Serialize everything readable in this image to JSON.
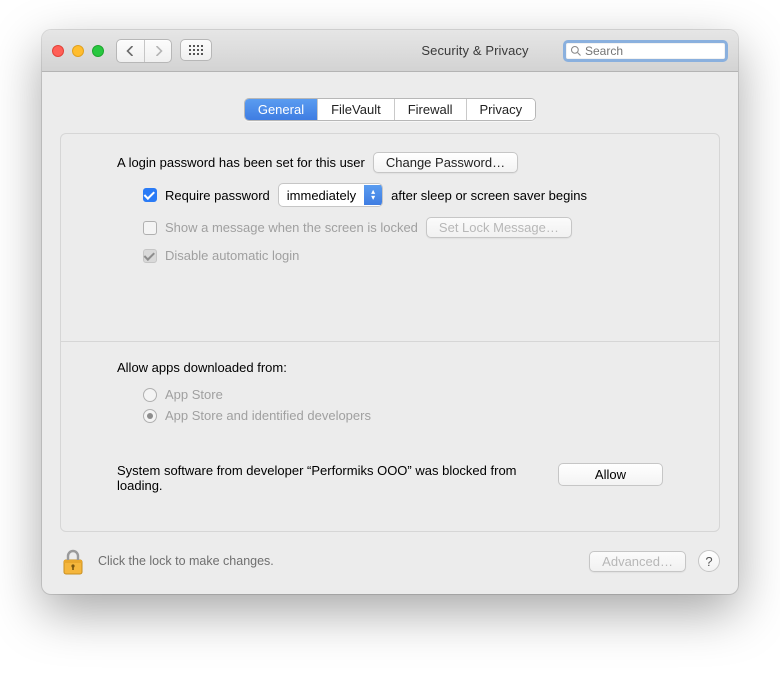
{
  "window": {
    "title": "Security & Privacy"
  },
  "search": {
    "placeholder": "Search"
  },
  "tabs": {
    "general": "General",
    "filevault": "FileVault",
    "firewall": "Firewall",
    "privacy": "Privacy"
  },
  "login": {
    "password_set_text": "A login password has been set for this user",
    "change_password_btn": "Change Password…",
    "require_password_label": "Require password",
    "delay_selected": "immediately",
    "after_sleep_text": "after sleep or screen saver begins",
    "show_message_label": "Show a message when the screen is locked",
    "set_lock_message_btn": "Set Lock Message…",
    "disable_auto_login_label": "Disable automatic login"
  },
  "download": {
    "heading": "Allow apps downloaded from:",
    "option_appstore": "App Store",
    "option_identified": "App Store and identified developers"
  },
  "blocked": {
    "text": "System software from developer “Performiks OOO” was blocked from loading.",
    "allow_btn": "Allow"
  },
  "footer": {
    "lock_hint": "Click the lock to make changes.",
    "advanced_btn": "Advanced…"
  }
}
